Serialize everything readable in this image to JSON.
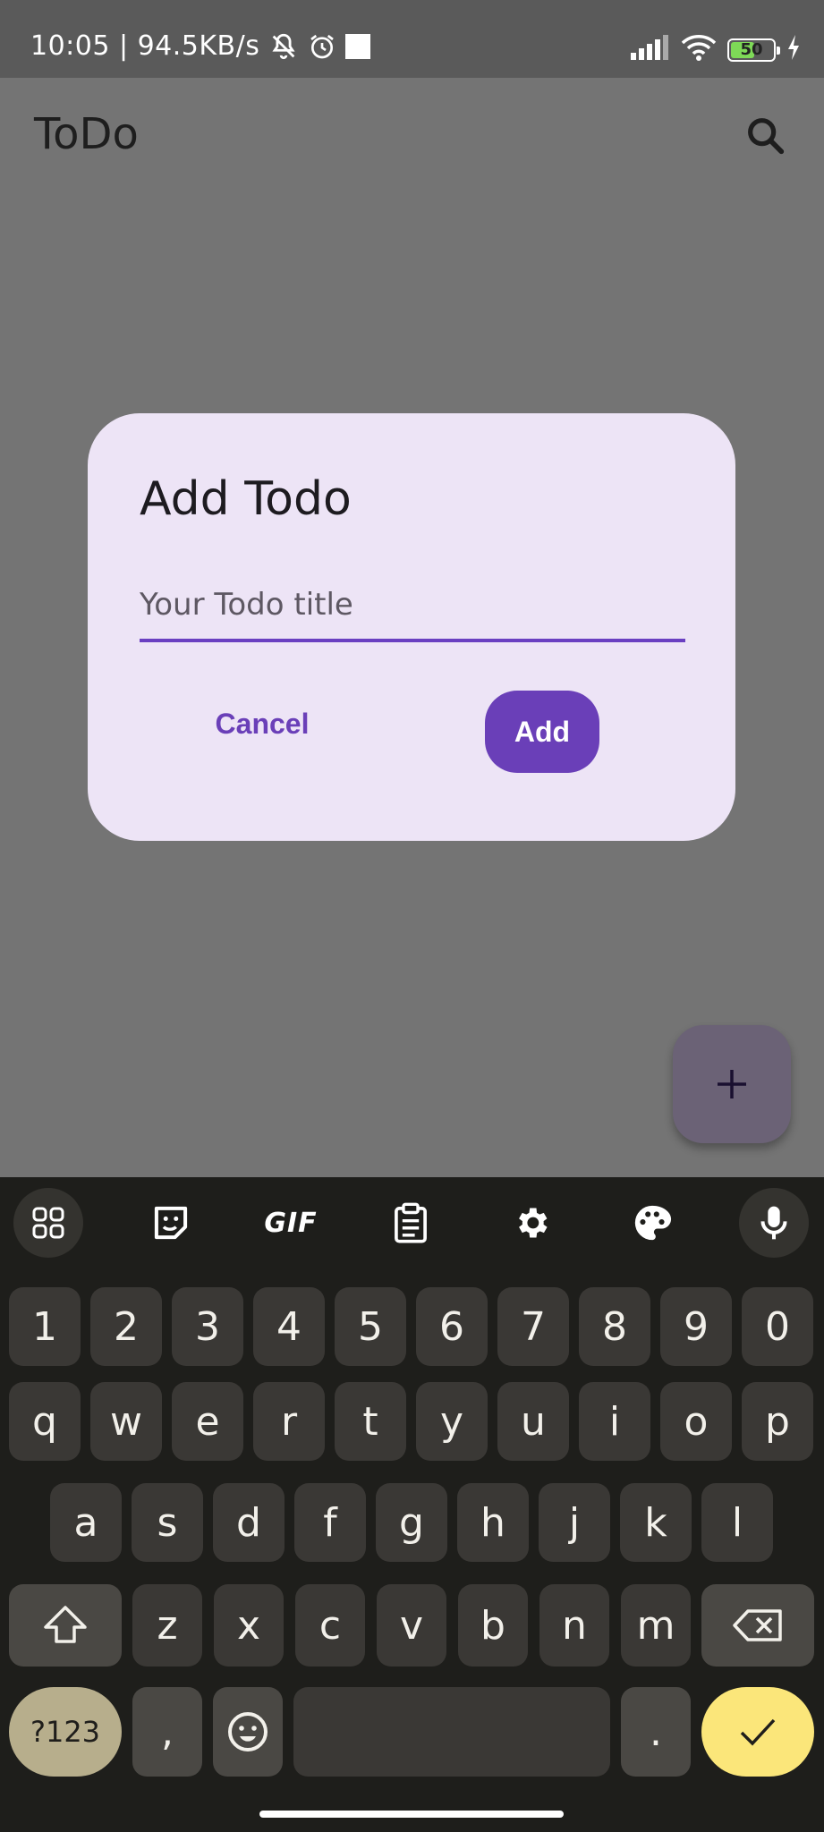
{
  "status_bar": {
    "time": "10:05",
    "speed": "94.5KB/s",
    "battery_level": "50"
  },
  "app_bar": {
    "title": "ToDo",
    "search_icon": "search-icon"
  },
  "dialog": {
    "title": "Add Todo",
    "input_placeholder": "Your Todo title",
    "input_value": "",
    "cancel_label": "Cancel",
    "add_label": "Add"
  },
  "fab": {
    "icon": "plus-icon"
  },
  "keyboard": {
    "toolbar": [
      "apps-icon",
      "sticker-icon",
      "GIF",
      "clipboard-icon",
      "settings-icon",
      "palette-icon",
      "mic-icon"
    ],
    "gif_label": "GIF",
    "row1": [
      "1",
      "2",
      "3",
      "4",
      "5",
      "6",
      "7",
      "8",
      "9",
      "0"
    ],
    "row2": [
      "q",
      "w",
      "e",
      "r",
      "t",
      "y",
      "u",
      "i",
      "o",
      "p"
    ],
    "row3": [
      "a",
      "s",
      "d",
      "f",
      "g",
      "h",
      "j",
      "k",
      "l"
    ],
    "row4": [
      "z",
      "x",
      "c",
      "v",
      "b",
      "n",
      "m"
    ],
    "mode_label": "?123",
    "comma": ",",
    "period": "."
  },
  "colors": {
    "accent": "#6a3fb8",
    "dialog_bg": "#ede4f6",
    "scrim": "#747474",
    "keyboard_bg": "#1e1e1b",
    "enter_key": "#fbe67a"
  }
}
